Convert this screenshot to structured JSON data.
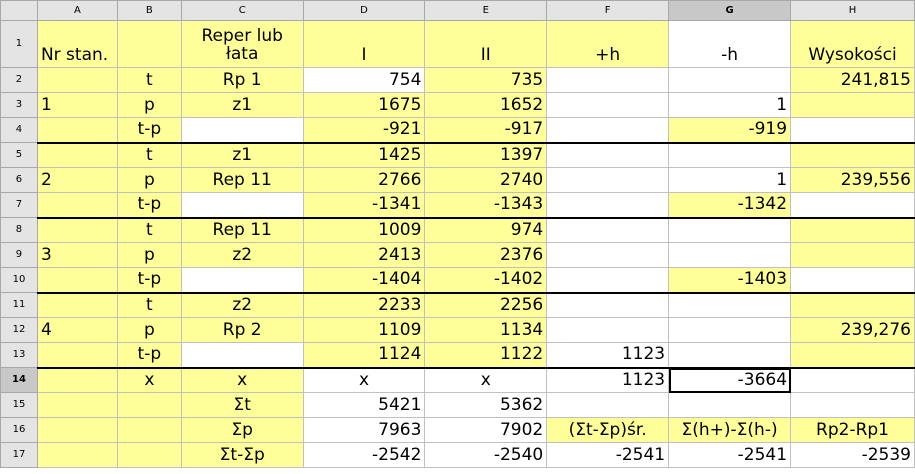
{
  "columns": [
    "A",
    "B",
    "C",
    "D",
    "E",
    "F",
    "G",
    "H"
  ],
  "selected_column": "G",
  "selected_row": 14,
  "rows": [
    {
      "num": "1",
      "cells": [
        "Nr stan.",
        "",
        "Reper lub łata",
        "I",
        "II",
        "+h",
        "-h",
        "Wysokości"
      ]
    },
    {
      "num": "2",
      "cells": [
        "",
        "t",
        "Rp 1",
        "754",
        "735",
        "",
        "",
        "241,815"
      ]
    },
    {
      "num": "3",
      "cells": [
        "1",
        "p",
        "z1",
        "1675",
        "1652",
        "",
        "1",
        ""
      ]
    },
    {
      "num": "4",
      "cells": [
        "",
        "t-p",
        "",
        "-921",
        "-917",
        "",
        "-919",
        ""
      ]
    },
    {
      "num": "5",
      "cells": [
        "",
        "t",
        "z1",
        "1425",
        "1397",
        "",
        "",
        ""
      ]
    },
    {
      "num": "6",
      "cells": [
        "2",
        "p",
        "Rep 11",
        "2766",
        "2740",
        "",
        "1",
        "239,556"
      ]
    },
    {
      "num": "7",
      "cells": [
        "",
        "t-p",
        "",
        "-1341",
        "-1343",
        "",
        "-1342",
        ""
      ]
    },
    {
      "num": "8",
      "cells": [
        "",
        "t",
        "Rep 11",
        "1009",
        "974",
        "",
        "",
        ""
      ]
    },
    {
      "num": "9",
      "cells": [
        "3",
        "p",
        "z2",
        "2413",
        "2376",
        "",
        "",
        ""
      ]
    },
    {
      "num": "10",
      "cells": [
        "",
        "t-p",
        "",
        "-1404",
        "-1402",
        "",
        "-1403",
        ""
      ]
    },
    {
      "num": "11",
      "cells": [
        "",
        "t",
        "z2",
        "2233",
        "2256",
        "",
        "",
        ""
      ]
    },
    {
      "num": "12",
      "cells": [
        "4",
        "p",
        "Rp 2",
        "1109",
        "1134",
        "",
        "",
        "239,276"
      ]
    },
    {
      "num": "13",
      "cells": [
        "",
        "t-p",
        "",
        "1124",
        "1122",
        "1123",
        "",
        ""
      ]
    },
    {
      "num": "14",
      "cells": [
        "",
        "x",
        "x",
        "x",
        "x",
        "1123",
        "-3664",
        ""
      ]
    },
    {
      "num": "15",
      "cells": [
        "",
        "",
        "Σt",
        "5421",
        "5362",
        "",
        "",
        ""
      ]
    },
    {
      "num": "16",
      "cells": [
        "",
        "",
        "Σp",
        "7963",
        "7902",
        "(Σt-Σp)śr.",
        "Σ(h+)-Σ(h-)",
        "Rp2-Rp1"
      ]
    },
    {
      "num": "17",
      "cells": [
        "",
        "",
        "Σt-Σp",
        "-2542",
        "-2540",
        "-2541",
        "-2541",
        "-2539"
      ]
    }
  ]
}
